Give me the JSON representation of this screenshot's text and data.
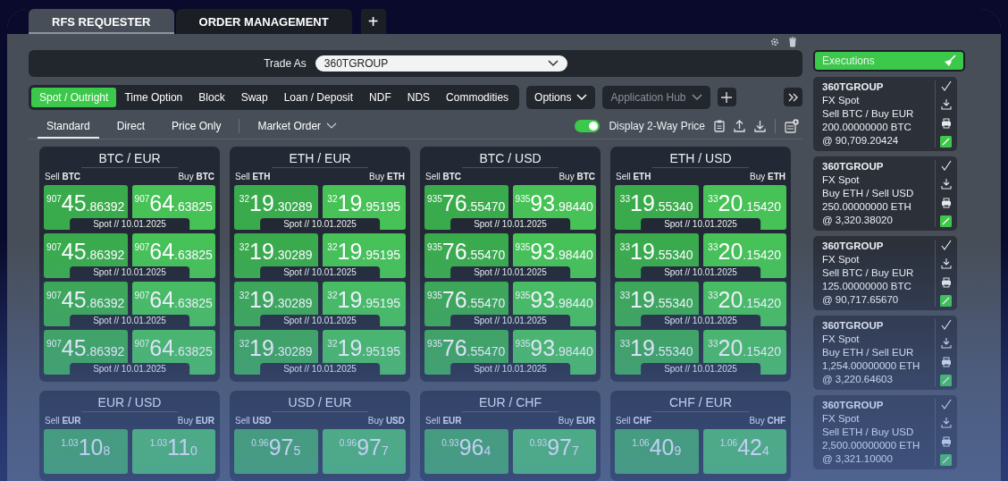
{
  "tabs": [
    {
      "label": "RFS REQUESTER",
      "selected": true
    },
    {
      "label": "ORDER MANAGEMENT",
      "selected": false
    }
  ],
  "add_tab": "+",
  "trade_as": {
    "label": "Trade As",
    "value": "360TGROUP"
  },
  "products": [
    {
      "label": "Spot / Outright",
      "selected": true
    },
    {
      "label": "Time Option",
      "selected": false
    },
    {
      "label": "Block",
      "selected": false
    },
    {
      "label": "Swap",
      "selected": false
    },
    {
      "label": "Loan / Deposit",
      "selected": false
    },
    {
      "label": "NDF",
      "selected": false
    },
    {
      "label": "NDS",
      "selected": false
    },
    {
      "label": "Commodities",
      "selected": false
    }
  ],
  "options_menu": {
    "label": "Options",
    "disabled": false
  },
  "app_hub_menu": {
    "label": "Application Hub",
    "disabled": true
  },
  "views": [
    {
      "label": "Standard",
      "selected": true
    },
    {
      "label": "Direct",
      "selected": false
    },
    {
      "label": "Price Only",
      "selected": false
    }
  ],
  "order_type": "Market Order",
  "two_way_toggle": {
    "label": "Display 2-Way Price",
    "on": true
  },
  "tiles": [
    {
      "pair": "BTC / EUR",
      "sell": "Sell **BTC**",
      "buy": "Buy **BTC**",
      "rows": [
        {
          "bid": {
            "prefix": "907",
            "big": "45",
            "rest": ".86392"
          },
          "ask": {
            "prefix": "907",
            "big": "64",
            "rest": ".63825"
          },
          "tenor": "Spot // 10.01.2025"
        },
        {
          "bid": {
            "prefix": "907",
            "big": "45",
            "rest": ".86392"
          },
          "ask": {
            "prefix": "907",
            "big": "64",
            "rest": ".63825"
          },
          "tenor": "Spot // 10.01.2025"
        },
        {
          "bid": {
            "prefix": "907",
            "big": "45",
            "rest": ".86392"
          },
          "ask": {
            "prefix": "907",
            "big": "64",
            "rest": ".63825"
          },
          "tenor": "Spot // 10.01.2025"
        },
        {
          "bid": {
            "prefix": "907",
            "big": "45",
            "rest": ".86392"
          },
          "ask": {
            "prefix": "907",
            "big": "64",
            "rest": ".63825"
          },
          "tenor": "Spot // 10.01.2025"
        }
      ]
    },
    {
      "pair": "ETH / EUR",
      "sell": "Sell **ETH**",
      "buy": "Buy **ETH**",
      "rows": [
        {
          "bid": {
            "prefix": "32",
            "big": "19",
            "rest": ".30289"
          },
          "ask": {
            "prefix": "32",
            "big": "19",
            "rest": ".95195"
          },
          "tenor": "Spot // 10.01.2025"
        },
        {
          "bid": {
            "prefix": "32",
            "big": "19",
            "rest": ".30289"
          },
          "ask": {
            "prefix": "32",
            "big": "19",
            "rest": ".95195"
          },
          "tenor": "Spot // 10.01.2025"
        },
        {
          "bid": {
            "prefix": "32",
            "big": "19",
            "rest": ".30289"
          },
          "ask": {
            "prefix": "32",
            "big": "19",
            "rest": ".95195"
          },
          "tenor": "Spot // 10.01.2025"
        },
        {
          "bid": {
            "prefix": "32",
            "big": "19",
            "rest": ".30289"
          },
          "ask": {
            "prefix": "32",
            "big": "19",
            "rest": ".95195"
          },
          "tenor": "Spot // 10.01.2025"
        }
      ]
    },
    {
      "pair": "BTC / USD",
      "sell": "Sell **BTC**",
      "buy": "Buy **BTC**",
      "rows": [
        {
          "bid": {
            "prefix": "935",
            "big": "76",
            "rest": ".55470"
          },
          "ask": {
            "prefix": "935",
            "big": "93",
            "rest": ".98440"
          },
          "tenor": "Spot // 10.01.2025"
        },
        {
          "bid": {
            "prefix": "935",
            "big": "76",
            "rest": ".55470"
          },
          "ask": {
            "prefix": "935",
            "big": "93",
            "rest": ".98440"
          },
          "tenor": "Spot // 10.01.2025"
        },
        {
          "bid": {
            "prefix": "935",
            "big": "76",
            "rest": ".55470"
          },
          "ask": {
            "prefix": "935",
            "big": "93",
            "rest": ".98440"
          },
          "tenor": "Spot // 10.01.2025"
        },
        {
          "bid": {
            "prefix": "935",
            "big": "76",
            "rest": ".55470"
          },
          "ask": {
            "prefix": "935",
            "big": "93",
            "rest": ".98440"
          },
          "tenor": "Spot // 10.01.2025"
        }
      ]
    },
    {
      "pair": "ETH / USD",
      "sell": "Sell **ETH**",
      "buy": "Buy **ETH**",
      "rows": [
        {
          "bid": {
            "prefix": "33",
            "big": "19",
            "rest": ".55340"
          },
          "ask": {
            "prefix": "33",
            "big": "20",
            "rest": ".15420"
          },
          "tenor": "Spot // 10.01.2025"
        },
        {
          "bid": {
            "prefix": "33",
            "big": "19",
            "rest": ".55340"
          },
          "ask": {
            "prefix": "33",
            "big": "20",
            "rest": ".15420"
          },
          "tenor": "Spot // 10.01.2025"
        },
        {
          "bid": {
            "prefix": "33",
            "big": "19",
            "rest": ".55340"
          },
          "ask": {
            "prefix": "33",
            "big": "20",
            "rest": ".15420"
          },
          "tenor": "Spot // 10.01.2025"
        },
        {
          "bid": {
            "prefix": "33",
            "big": "19",
            "rest": ".55340"
          },
          "ask": {
            "prefix": "33",
            "big": "20",
            "rest": ".15420"
          },
          "tenor": "Spot // 10.01.2025"
        }
      ]
    },
    {
      "pair": "EUR / USD",
      "sell": "Sell **EUR**",
      "buy": "Buy **EUR**",
      "rows": [
        {
          "bid": {
            "prefix": "1.03",
            "big": "10",
            "rest": "8"
          },
          "ask": {
            "prefix": "1.03",
            "big": "11",
            "rest": "0"
          }
        }
      ]
    },
    {
      "pair": "USD / EUR",
      "sell": "Sell **USD**",
      "buy": "Buy **USD**",
      "rows": [
        {
          "bid": {
            "prefix": "0.96",
            "big": "97",
            "rest": "5"
          },
          "ask": {
            "prefix": "0.96",
            "big": "97",
            "rest": "7"
          }
        }
      ]
    },
    {
      "pair": "EUR / CHF",
      "sell": "Sell **EUR**",
      "buy": "Buy **EUR**",
      "rows": [
        {
          "bid": {
            "prefix": "0.93",
            "big": "96",
            "rest": "4"
          },
          "ask": {
            "prefix": "0.93",
            "big": "97",
            "rest": "7"
          }
        }
      ]
    },
    {
      "pair": "CHF / EUR",
      "sell": "Sell **CHF**",
      "buy": "Buy **CHF**",
      "rows": [
        {
          "bid": {
            "prefix": "1.06",
            "big": "40",
            "rest": "9"
          },
          "ask": {
            "prefix": "1.06",
            "big": "42",
            "rest": "4"
          }
        }
      ]
    }
  ],
  "executions": {
    "title": "Executions",
    "items": [
      {
        "entity": "360TGROUP",
        "product": "FX Spot",
        "side": "Sell BTC / Buy EUR",
        "amount": "200.00000000 BTC",
        "rate": "@ 90,709.20424"
      },
      {
        "entity": "360TGROUP",
        "product": "FX Spot",
        "side": "Buy ETH / Sell USD",
        "amount": "250.00000000 ETH",
        "rate": "@ 3,320.38020"
      },
      {
        "entity": "360TGROUP",
        "product": "FX Spot",
        "side": "Sell BTC / Buy EUR",
        "amount": "125.00000000 BTC",
        "rate": "@ 90,717.65670"
      },
      {
        "entity": "360TGROUP",
        "product": "FX Spot",
        "side": "Buy ETH / Sell EUR",
        "amount": "1,254.00000000 ETH",
        "rate": "@ 3,220.64603"
      },
      {
        "entity": "360TGROUP",
        "product": "FX Spot",
        "side": "Sell ETH / Buy USD",
        "amount": "2,500.00000000 ETH",
        "rate": "@ 3,321.10000"
      }
    ]
  }
}
